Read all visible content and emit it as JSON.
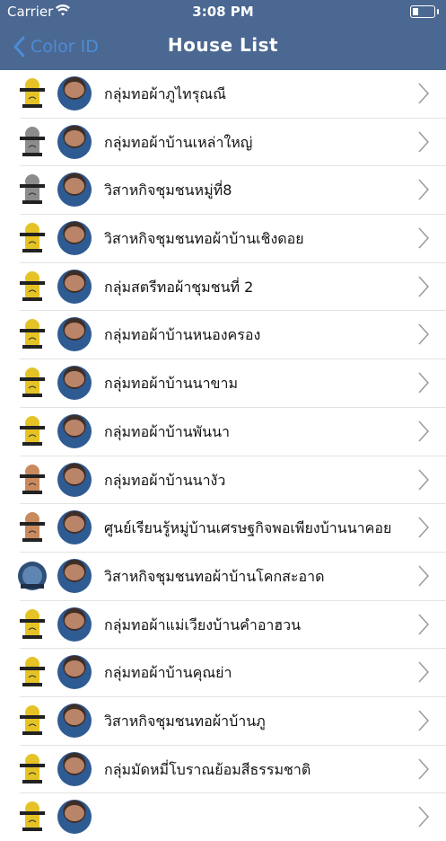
{
  "status_bar": {
    "carrier": "Carrier",
    "time": "3:08 PM"
  },
  "nav": {
    "back_label": "Color ID",
    "title": "House List"
  },
  "colors": {
    "nav_bg": "#4a6891",
    "back_tint": "#4d8cd6",
    "logo_gold": "#e5c326",
    "logo_silver": "#8c8c8c",
    "logo_bronze": "#c98a5e",
    "logo_blue": "#2f4f77"
  },
  "houses": [
    {
      "name": "กลุ่มทอผ้าภูไทรุณณี",
      "badge": "gold"
    },
    {
      "name": "กลุ่มทอผ้าบ้านเหล่าใหญ่",
      "badge": "silver"
    },
    {
      "name": "วิสาหกิจชุมชนหมู่ที่8",
      "badge": "silver"
    },
    {
      "name": "วิสาหกิจชุมชนทอผ้าบ้านเชิงดอย",
      "badge": "gold"
    },
    {
      "name": "กลุ่มสตรีทอผ้าชุมชนที่ 2",
      "badge": "gold"
    },
    {
      "name": "กลุ่มทอผ้าบ้านหนองครอง",
      "badge": "gold"
    },
    {
      "name": "กลุ่มทอผ้าบ้านนาขาม",
      "badge": "gold"
    },
    {
      "name": "กลุ่มทอผ้าบ้านพันนา",
      "badge": "gold"
    },
    {
      "name": "กลุ่มทอผ้าบ้านนางัว",
      "badge": "bronze"
    },
    {
      "name": "ศูนย์เรียนรู้หมู่บ้านเศรษฐกิจพอเพียงบ้านนาคอย",
      "badge": "bronze"
    },
    {
      "name": "วิสาหกิจชุมชนทอผ้าบ้านโคกสะอาด",
      "badge": "blue"
    },
    {
      "name": "กลุ่มทอผ้าแม่เวียงบ้านคำอาฮวน",
      "badge": "gold"
    },
    {
      "name": "กลุ่มทอผ้าบ้านคุณย่า",
      "badge": "gold"
    },
    {
      "name": "วิสาหกิจชุมชนทอผ้าบ้านภู",
      "badge": "gold"
    },
    {
      "name": "กลุ่มมัดหมี่โบราณย้อมสีธรรมชาติ",
      "badge": "gold"
    },
    {
      "name": "",
      "badge": "gold"
    }
  ],
  "icons": {
    "back": "chevron-left-icon",
    "disclosure": "chevron-right-icon",
    "wifi": "wifi-icon",
    "battery": "battery-icon"
  }
}
